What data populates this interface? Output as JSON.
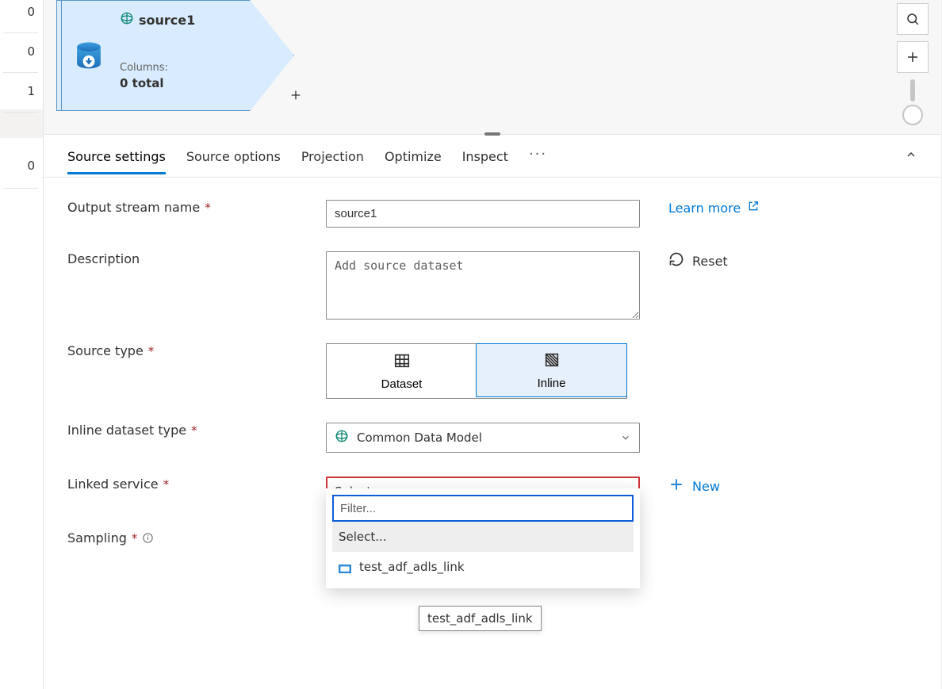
{
  "gutter": {
    "n1": "0",
    "n2": "0",
    "n3": "1",
    "n4": "0"
  },
  "node": {
    "title": "source1",
    "columns_label": "Columns:",
    "columns_value": "0 total"
  },
  "tabs": {
    "settings": "Source settings",
    "options": "Source options",
    "projection": "Projection",
    "optimize": "Optimize",
    "inspect": "Inspect"
  },
  "form": {
    "output_stream_label": "Output stream name",
    "output_stream_value": "source1",
    "description_label": "Description",
    "description_placeholder": "Add source dataset",
    "source_type_label": "Source type",
    "source_type_dataset": "Dataset",
    "source_type_inline": "Inline",
    "inline_type_label": "Inline dataset type",
    "inline_type_value": "Common Data Model",
    "linked_service_label": "Linked service",
    "linked_service_placeholder": "Select...",
    "new_label": "New",
    "sampling_label": "Sampling",
    "learn_more": "Learn more",
    "reset": "Reset"
  },
  "dropdown": {
    "filter_placeholder": "Filter...",
    "opt_placeholder": "Select...",
    "opt_value": "test_adf_adls_link"
  },
  "tooltip": {
    "text": "test_adf_adls_link"
  }
}
